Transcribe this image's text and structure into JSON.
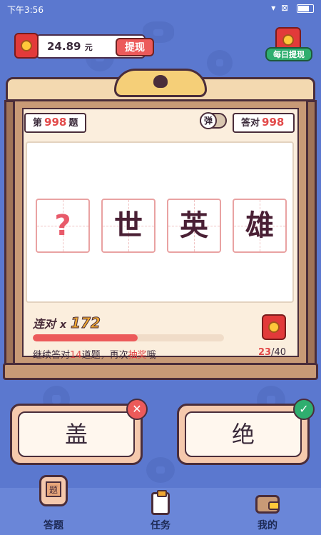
{
  "status_bar": {
    "time": "下午3:56",
    "icons": "▾ ⊠"
  },
  "balance": {
    "amount": "24.89",
    "unit": "元",
    "withdraw_label": "提现"
  },
  "daily_withdraw": {
    "label": "每日提现"
  },
  "quiz": {
    "question_prefix": "第",
    "question_number": "998",
    "question_suffix": "题",
    "toggle_label": "弹",
    "correct_prefix": "答对",
    "correct_count": "998",
    "characters": [
      "?",
      "世",
      "英",
      "雄"
    ],
    "streak_label": "连对",
    "streak_x": "x",
    "streak_count": "172",
    "progress_fraction": 0.55,
    "hint_part1": "继续答对",
    "hint_number": "14",
    "hint_part2": "道题，再次",
    "hint_highlight": "抽奖",
    "hint_part3": "哦",
    "reward_current": "23",
    "reward_total": "/40"
  },
  "answers": [
    {
      "label": "盖",
      "badge": "✕"
    },
    {
      "label": "绝",
      "badge": "✓"
    }
  ],
  "nav": [
    {
      "label": "答题",
      "icon": "quiz-lantern-icon"
    },
    {
      "label": "任务",
      "icon": "task-clipboard-icon"
    },
    {
      "label": "我的",
      "icon": "wallet-icon"
    }
  ],
  "colors": {
    "background": "#5b78cf",
    "accent_red": "#ec5a5a",
    "accent_green": "#2fae6f"
  }
}
